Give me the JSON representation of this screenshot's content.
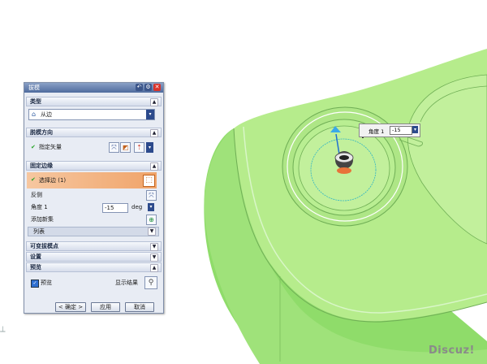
{
  "dialog": {
    "title": "拔模",
    "sections": {
      "type": {
        "label": "类型",
        "value": "从边"
      },
      "draw_direction": {
        "label": "脱模方向",
        "specify_vector": "指定矢量"
      },
      "fixed_edges": {
        "label": "固定边缘",
        "select_edge": "选择边 (1)",
        "reverse": "反侧",
        "angle_label": "角度 1",
        "angle_value": "-15",
        "angle_unit": "deg",
        "add_set": "添加新集",
        "list": "列表"
      },
      "variable_points": {
        "label": "可变拔模点"
      },
      "settings": {
        "label": "设置"
      },
      "preview": {
        "label": "预览",
        "checkbox": "预览",
        "show_result": "显示结果"
      }
    },
    "buttons": {
      "ok": "< 确定 >",
      "apply": "应用",
      "cancel": "取消"
    }
  },
  "viewport": {
    "angle_handle": {
      "label": "角度 1",
      "value": "-15"
    },
    "watermark": "Discuz!",
    "model_color": "#b6ec8c"
  }
}
